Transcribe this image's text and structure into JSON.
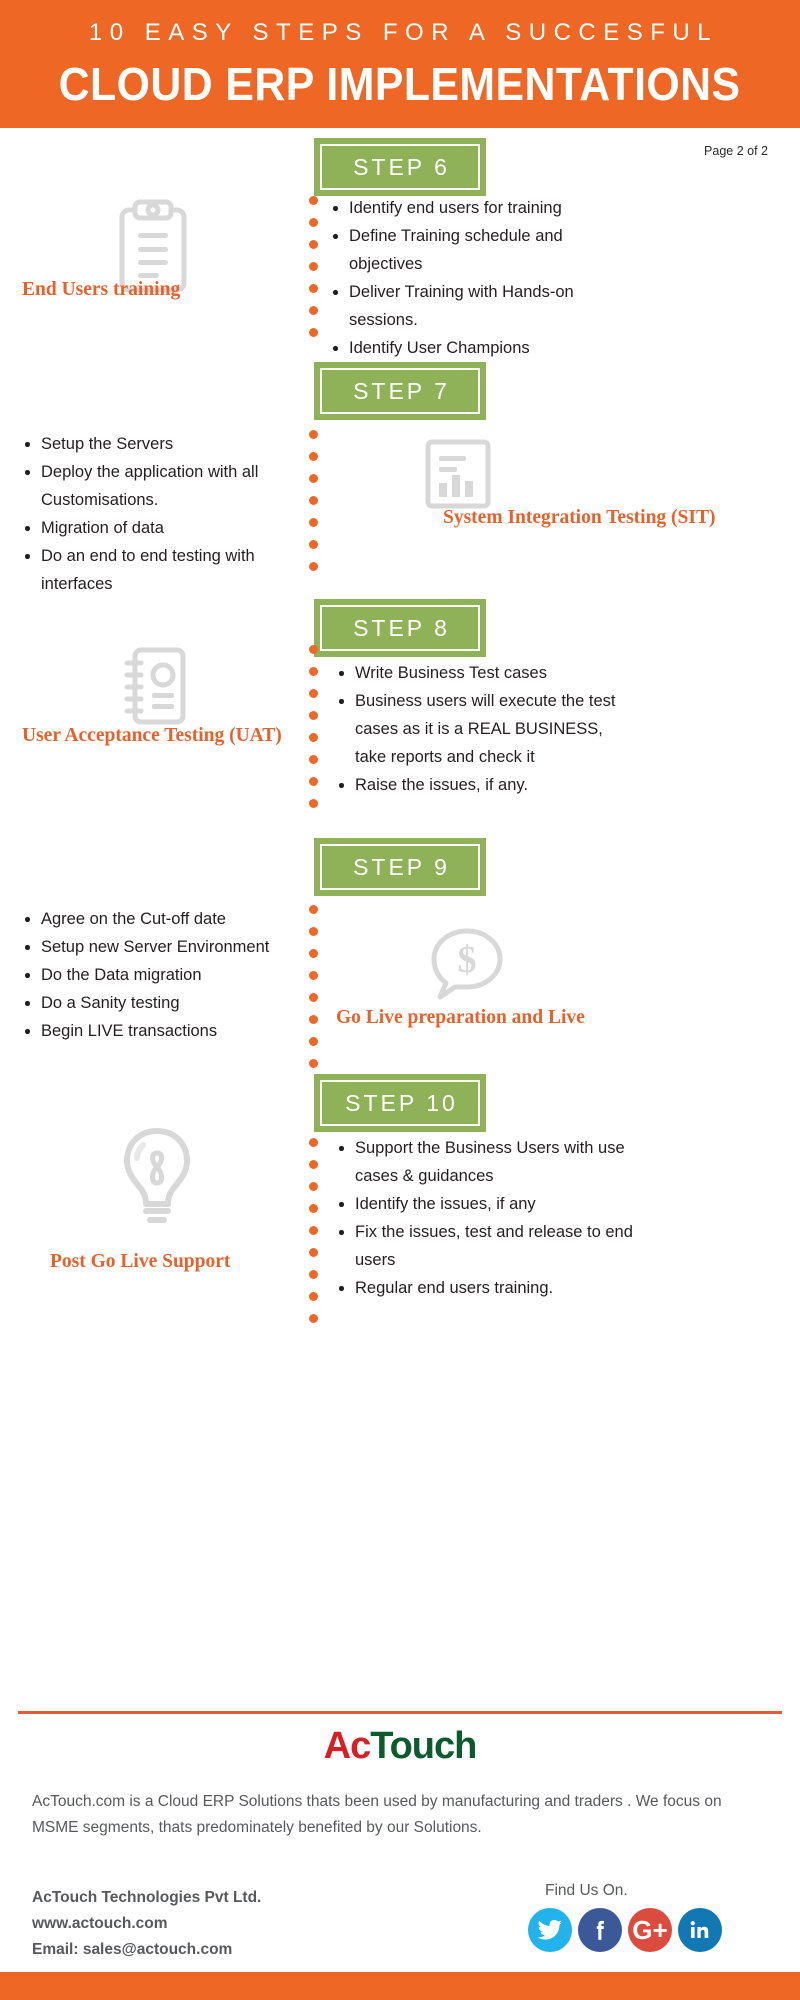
{
  "header": {
    "kicker": "10 EASY STEPS FOR A SUCCESFUL",
    "title": "CLOUD ERP IMPLEMENTATIONS",
    "bg_color": "#ef6724"
  },
  "page_indicator": "Page 2 of 2",
  "theme": {
    "orange": "#ef6724",
    "green": "#8fb157",
    "label_orange": "#e8612c",
    "icon_gray": "#d8d8d8",
    "text_dark": "#231f20"
  },
  "steps": [
    {
      "badge": "STEP 6",
      "label": "End Users training",
      "icon": "clipboard-icon",
      "side": "icon-left",
      "bullets": [
        "Identify end users for training",
        "Define Training schedule and objectives",
        "Deliver Training with Hands-on sessions.",
        "Identify User Champions"
      ]
    },
    {
      "badge": "STEP 7",
      "label": "System Integration Testing (SIT)",
      "icon": "bar-chart-report-icon",
      "side": "icon-right",
      "bullets": [
        "Setup the Servers",
        "Deploy the application with all Customisations.",
        "Migration of data",
        "Do an end to end testing with interfaces"
      ]
    },
    {
      "badge": "STEP 8",
      "label": "User Acceptance Testing (UAT)",
      "icon": "address-book-icon",
      "side": "icon-left",
      "bullets": [
        "Write Business Test cases",
        "Business users will execute the test cases as it is a REAL BUSINESS, take reports and check it",
        "Raise the issues, if any."
      ]
    },
    {
      "badge": "STEP 9",
      "label": "Go Live preparation and Live",
      "icon": "dollar-speech-bubble-icon",
      "side": "icon-right",
      "bullets": [
        "Agree on the Cut-off date",
        "Setup new Server Environment",
        "Do the Data migration",
        "Do a Sanity testing",
        "Begin LIVE transactions"
      ]
    },
    {
      "badge": "STEP 10",
      "label": "Post Go Live Support",
      "icon": "lightbulb-icon",
      "side": "icon-left",
      "bullets": [
        "Support the Business Users with use cases & guidances",
        "Identify the issues, if any",
        "Fix the issues, test and release to end users",
        "Regular end users training."
      ]
    }
  ],
  "footer": {
    "logo_part1": "Ac",
    "logo_part2": "Touch",
    "logo_color1": "#d81f26",
    "logo_color2": "#0d5a2d",
    "description": "AcTouch.com is a Cloud ERP Solutions thats been used by manufacturing and traders . We focus on MSME segments, thats predominately benefited by our Solutions.",
    "company": "AcTouch Technologies Pvt Ltd.",
    "website": "www.actouch.com",
    "email": "Email: sales@actouch.com",
    "find_us": "Find Us On.",
    "social": [
      {
        "name": "twitter",
        "glyph": "ᴠ",
        "color": "#22b2ec"
      },
      {
        "name": "facebook",
        "glyph": "f",
        "color": "#3b5998"
      },
      {
        "name": "google-plus",
        "glyph": "G+",
        "color": "#dc4b3e"
      },
      {
        "name": "linkedin",
        "glyph": "in",
        "color": "#1178b3"
      }
    ]
  }
}
